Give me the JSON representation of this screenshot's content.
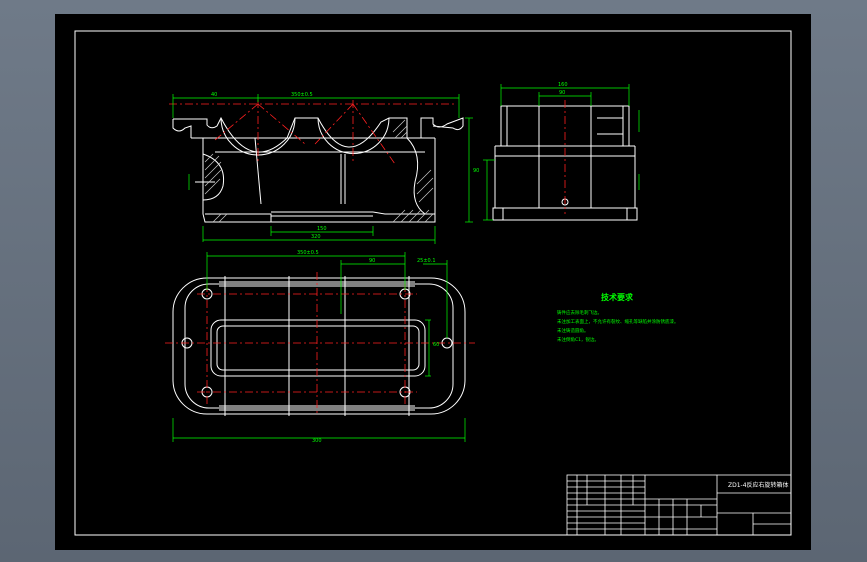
{
  "drawing": {
    "title_block": {
      "drawing_title": "ZD1-4反应右旋转箱体"
    },
    "technical_requirements": {
      "heading": "技术要求",
      "items": [
        "铸件应去除毛刺飞边。",
        "未注加工表面上，不允许有裂纹、缩孔等缺陷并涂防锈底漆。",
        "未注铸造圆角。",
        "未注倒角C1，锐边。"
      ]
    },
    "dimensions": {
      "front_top_left": "40",
      "front_top_right": "350±0.5",
      "front_height": "90",
      "front_bottom_inner": "150",
      "front_bottom_overall": "320",
      "side_top_overall": "160",
      "side_top_inner": "90",
      "plan_top_span": "350±0.5",
      "plan_top_inner": "90",
      "plan_top_right": "25±0.1",
      "plan_bottom_overall": "300",
      "plan_side": "60"
    },
    "colors": {
      "background": "#000000",
      "outline": "#ffffff",
      "dimension": "#00ff00",
      "centerline": "#ff2020",
      "hatch": "#c8c8c8"
    }
  }
}
